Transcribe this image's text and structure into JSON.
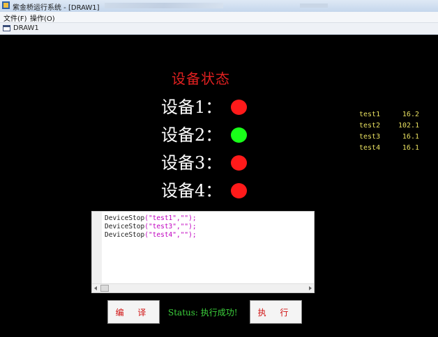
{
  "window": {
    "title": "紫金桥运行系统 - [DRAW1]"
  },
  "menu": {
    "items": [
      {
        "label": "文件(F)"
      },
      {
        "label": "操作(O)"
      }
    ]
  },
  "doc_tab": {
    "label": "DRAW1"
  },
  "panel": {
    "title": "设备状态",
    "devices": [
      {
        "label": "设备1：",
        "state": "red",
        "color": "#ff1a1a"
      },
      {
        "label": "设备2：",
        "state": "green",
        "color": "#19ff19"
      },
      {
        "label": "设备3：",
        "state": "red",
        "color": "#ff1a1a"
      },
      {
        "label": "设备4：",
        "state": "red",
        "color": "#ff1a1a"
      }
    ]
  },
  "tags": [
    {
      "name": "test1",
      "value": "16.2"
    },
    {
      "name": "test2",
      "value": "102.1"
    },
    {
      "name": "test3",
      "value": "16.1"
    },
    {
      "name": "test4",
      "value": "16.1"
    }
  ],
  "editor": {
    "lines": [
      {
        "fn": "DeviceStop",
        "arg": "\"test1\",\"\"",
        "tail": ");"
      },
      {
        "fn": "DeviceStop",
        "arg": "\"test3\",\"\"",
        "tail": ");"
      },
      {
        "fn": "DeviceStop",
        "arg": "\"test4\",\"\"",
        "tail": ");"
      }
    ]
  },
  "controls": {
    "compile_label": "编 译",
    "execute_label": "执 行",
    "status_text": "Status: 执行成功!"
  }
}
